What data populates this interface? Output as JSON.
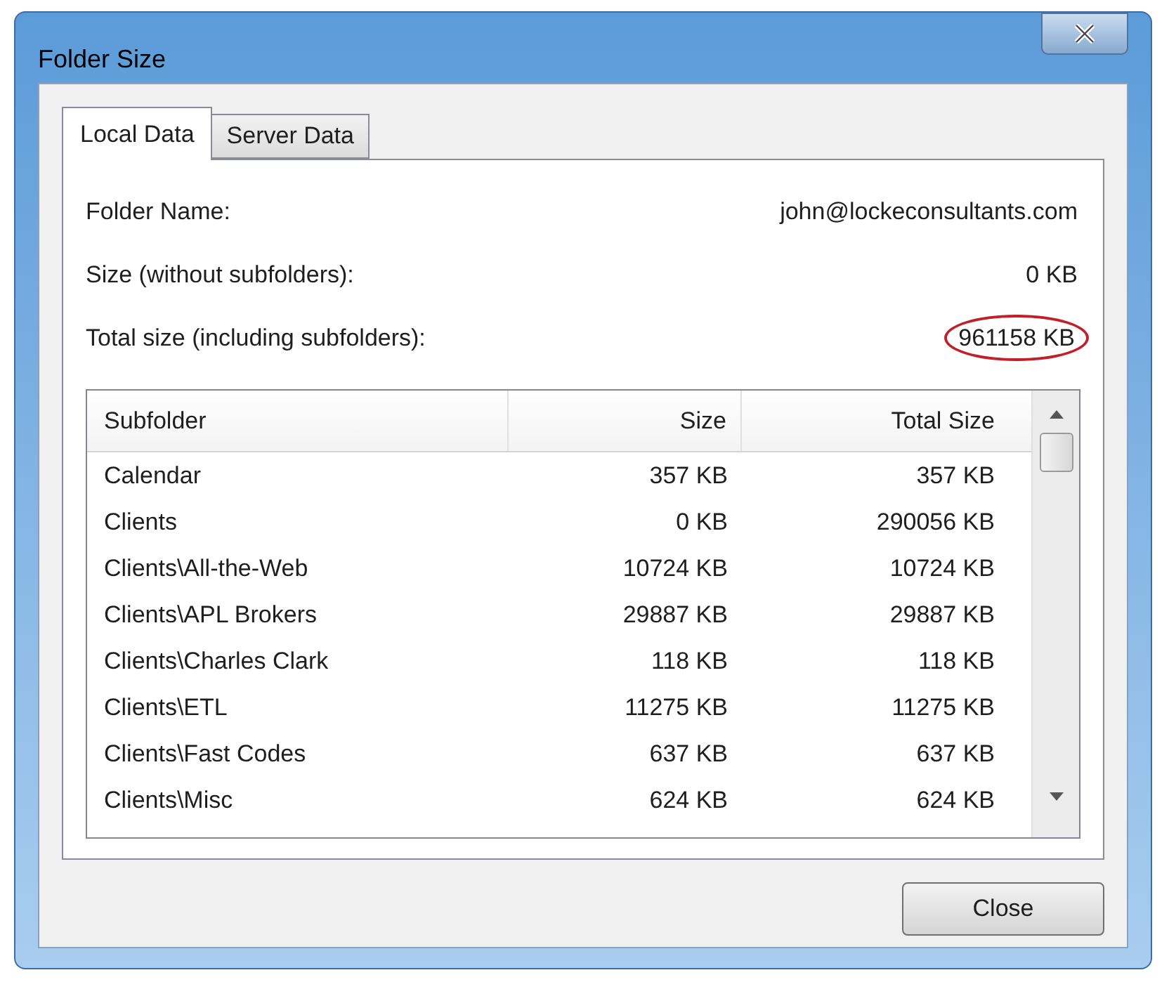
{
  "window": {
    "title": "Folder Size"
  },
  "tabs": [
    {
      "label": "Local Data",
      "selected": true
    },
    {
      "label": "Server Data",
      "selected": false
    }
  ],
  "fields": [
    {
      "label": "Folder Name:",
      "value": "john@lockeconsultants.com",
      "circled": false
    },
    {
      "label": "Size (without subfolders):",
      "value": "0 KB",
      "circled": false
    },
    {
      "label": "Total size (including subfolders):",
      "value": "961158 KB",
      "circled": true
    }
  ],
  "table": {
    "columns": [
      "Subfolder",
      "Size",
      "Total Size"
    ],
    "rows": [
      [
        "Calendar",
        "357 KB",
        "357 KB"
      ],
      [
        "Clients",
        "0 KB",
        "290056 KB"
      ],
      [
        "Clients\\All-the-Web",
        "10724 KB",
        "10724 KB"
      ],
      [
        "Clients\\APL Brokers",
        "29887 KB",
        "29887 KB"
      ],
      [
        "Clients\\Charles Clark",
        "118 KB",
        "118 KB"
      ],
      [
        "Clients\\ETL",
        "11275 KB",
        "11275 KB"
      ],
      [
        "Clients\\Fast Codes",
        "637 KB",
        "637 KB"
      ],
      [
        "Clients\\Misc",
        "624 KB",
        "624 KB"
      ]
    ]
  },
  "buttons": [
    "Close"
  ]
}
